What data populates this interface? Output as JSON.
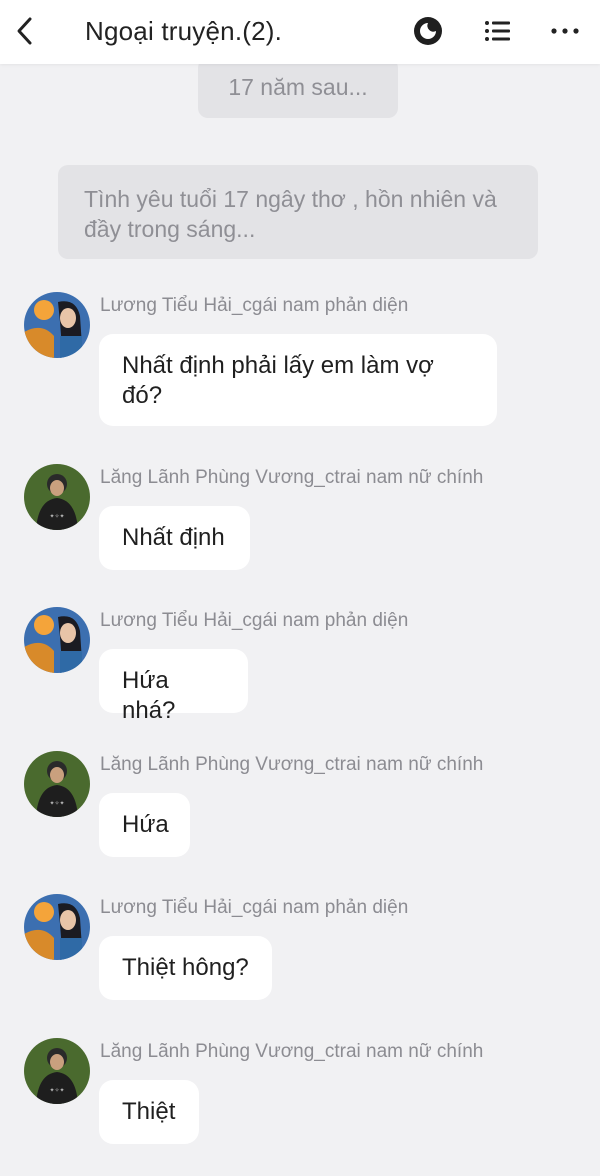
{
  "header": {
    "title": "Ngoại truyện.(2).",
    "icons": [
      "back-icon",
      "night-mode-icon",
      "chapter-list-icon",
      "more-icon"
    ]
  },
  "system_messages": [
    "17 năm sau...",
    "Tình yêu tuổi 17 ngây thơ , hồn nhiên và đầy trong sáng..."
  ],
  "messages": [
    {
      "sender": "Lương Tiểu Hải_cgái nam phản diện",
      "text": "Nhất định phải lấy em làm vợ đó?",
      "avatar": "girl-avatar"
    },
    {
      "sender": "Lăng Lãnh Phùng Vương_ctrai nam nữ chính",
      "text": "Nhất định",
      "avatar": "boy-avatar"
    },
    {
      "sender": "Lương Tiểu Hải_cgái nam phản diện",
      "text": "Hứa nhá?",
      "avatar": "girl-avatar"
    },
    {
      "sender": "Lăng Lãnh Phùng Vương_ctrai nam nữ chính",
      "text": "Hứa",
      "avatar": "boy-avatar"
    },
    {
      "sender": "Lương Tiểu Hải_cgái nam phản diện",
      "text": "Thiệt hông?",
      "avatar": "girl-avatar"
    },
    {
      "sender": "Lăng Lãnh Phùng Vương_ctrai nam nữ chính",
      "text": "Thiệt",
      "avatar": "boy-avatar"
    }
  ]
}
